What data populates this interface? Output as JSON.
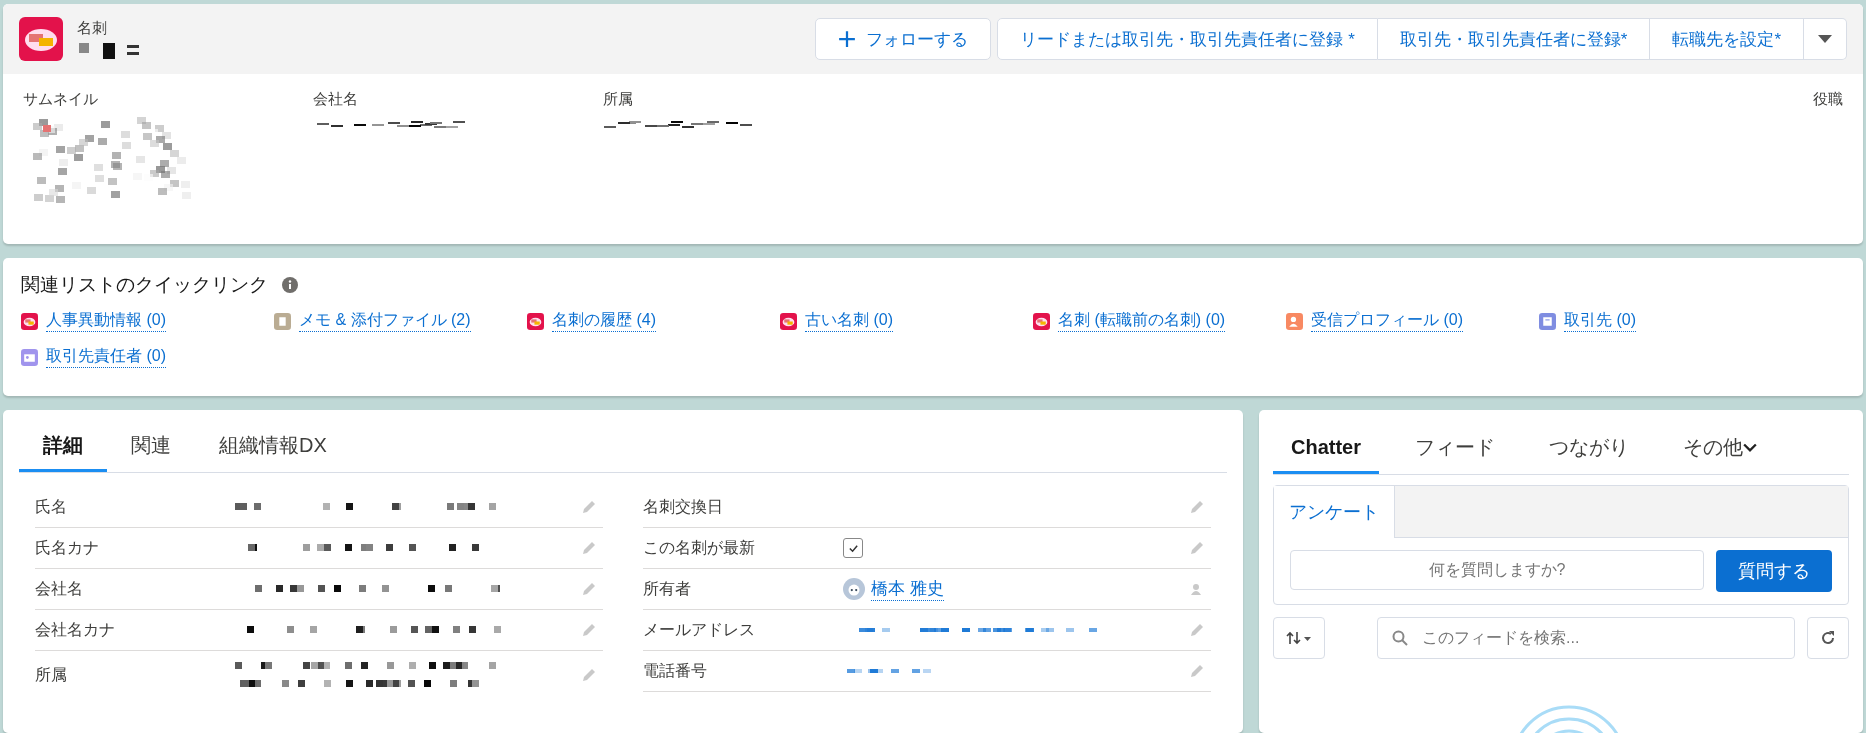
{
  "header": {
    "object_label": "名刺",
    "actions": [
      {
        "label": "フォローする",
        "kind": "follow"
      },
      {
        "label": "リードまたは取引先・取引先責任者に登録 *",
        "kind": "action"
      },
      {
        "label": "取引先・取引先責任者に登録*",
        "kind": "action"
      },
      {
        "label": "転職先を設定*",
        "kind": "action"
      },
      {
        "kind": "menu"
      }
    ],
    "fields": [
      {
        "label": "サムネイル",
        "kind": "image"
      },
      {
        "label": "会社名",
        "kind": "text"
      },
      {
        "label": "所属",
        "kind": "text"
      },
      {
        "label": "役職",
        "kind": "empty"
      }
    ]
  },
  "quick_links": {
    "title": "関連リストのクイックリンク",
    "items": [
      {
        "label": "人事異動情報 (0)",
        "kind": "card",
        "color": "#e3124b"
      },
      {
        "label": "メモ & 添付ファイル (2)",
        "kind": "note",
        "color": "#baac93"
      },
      {
        "label": "名刺の履歴 (4)",
        "kind": "card",
        "color": "#e3124b"
      },
      {
        "label": "古い名刺 (0)",
        "kind": "card",
        "color": "#e3124b"
      },
      {
        "label": "名刺 (転職前の名刺) (0)",
        "kind": "card",
        "color": "#e3124b"
      },
      {
        "label": "受信プロフィール (0)",
        "kind": "profile",
        "color": "#f88962"
      },
      {
        "label": "取引先 (0)",
        "kind": "account",
        "color": "#7f8de1"
      },
      {
        "label": "取引先責任者 (0)",
        "kind": "contact",
        "color": "#a094ed"
      }
    ]
  },
  "detail": {
    "tabs": [
      {
        "label": "詳細",
        "selected": true
      },
      {
        "label": "関連",
        "selected": false
      },
      {
        "label": "組織情報DX",
        "selected": false
      }
    ],
    "left_fields": [
      {
        "label": "氏名",
        "kind": "redacted"
      },
      {
        "label": "氏名カナ",
        "kind": "redacted"
      },
      {
        "label": "会社名",
        "kind": "redacted"
      },
      {
        "label": "会社名カナ",
        "kind": "redacted"
      },
      {
        "label": "所属",
        "kind": "redacted2"
      }
    ],
    "right_fields": [
      {
        "label": "名刺交換日",
        "kind": "empty"
      },
      {
        "label": "この名刺が最新",
        "kind": "checkbox",
        "checked": true
      },
      {
        "label": "所有者",
        "kind": "user",
        "value": "橋本 雅史"
      },
      {
        "label": "メールアドレス",
        "kind": "redacted_link"
      },
      {
        "label": "電話番号",
        "kind": "redacted_link_short"
      }
    ]
  },
  "chatter": {
    "tabs": [
      {
        "label": "Chatter",
        "selected": true
      },
      {
        "label": "フィード",
        "selected": false
      },
      {
        "label": "つながり",
        "selected": false
      },
      {
        "label": "その他",
        "selected": false,
        "dropdown": true
      }
    ],
    "publisher_tabs": [
      {
        "label": "アンケート",
        "selected": true
      }
    ],
    "question": {
      "placeholder": "何を質問しますか?"
    },
    "ask_button": "質問する",
    "search": {
      "placeholder": "このフィードを検索..."
    }
  }
}
